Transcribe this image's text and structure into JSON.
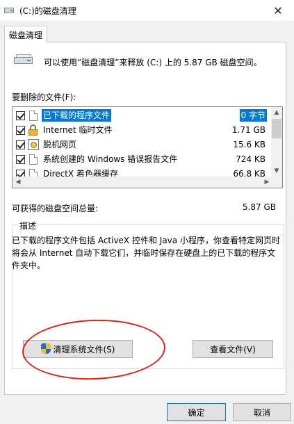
{
  "window": {
    "title": "(C:)的磁盘清理",
    "close_glyph": "✕"
  },
  "tab": {
    "label": "磁盘清理"
  },
  "intro": {
    "text": "可以使用“磁盘清理”来释放  (C:) 上的 5.87 GB 磁盘空间。"
  },
  "files": {
    "label": "要删除的文件(F):",
    "items": [
      {
        "name": "已下载的程序文件",
        "size": "0 字节",
        "checked": true,
        "icon": "folder-doc-icon"
      },
      {
        "name": "Internet 临时文件",
        "size": "1.71 GB",
        "checked": true,
        "icon": "lock-icon"
      },
      {
        "name": "脱机网页",
        "size": "15.6 KB",
        "checked": true,
        "icon": "web-page-icon"
      },
      {
        "name": "系统创建的 Windows 错误报告文件",
        "size": "724 KB",
        "checked": true,
        "icon": "document-icon"
      },
      {
        "name": "DirectX 着色器缓存",
        "size": "66.8 KB",
        "checked": true,
        "icon": "document-icon"
      }
    ]
  },
  "total": {
    "label": "可获得的磁盘空间总量:",
    "value": "5.87 GB"
  },
  "description": {
    "legend": "描述",
    "text": "已下载的程序文件包括 ActiveX 控件和 Java 小程序，你查看特定网页时将会从 Internet 自动下载它们，并临时保存在硬盘上的已下载的程序文件夹中。"
  },
  "buttons": {
    "cleanup_system": "清理系统文件(S)",
    "view_files": "查看文件(V)",
    "ok": "确定",
    "cancel": "取消"
  },
  "colors": {
    "selection": "#0078d7",
    "annotation": "#d8231f"
  }
}
